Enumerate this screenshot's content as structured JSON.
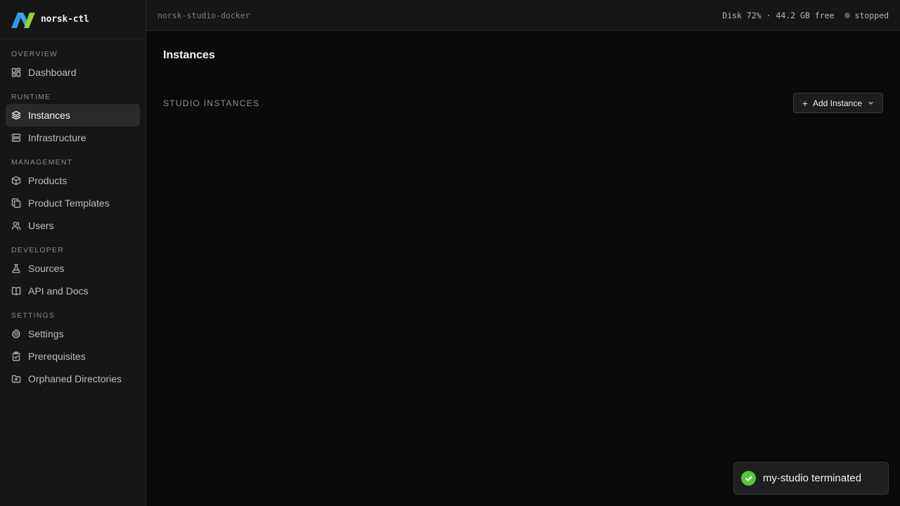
{
  "app": {
    "name": "norsk-ctl"
  },
  "topbar": {
    "host": "norsk-studio-docker",
    "disk": "Disk 72% · 44.2 GB free",
    "status": "stopped"
  },
  "sidebar": {
    "sections": [
      {
        "label": "OVERVIEW",
        "items": [
          {
            "label": "Dashboard",
            "icon": "dashboard-icon",
            "active": false
          }
        ]
      },
      {
        "label": "RUNTIME",
        "items": [
          {
            "label": "Instances",
            "icon": "layers-icon",
            "active": true
          },
          {
            "label": "Infrastructure",
            "icon": "server-icon",
            "active": false
          }
        ]
      },
      {
        "label": "MANAGEMENT",
        "items": [
          {
            "label": "Products",
            "icon": "box-icon",
            "active": false
          },
          {
            "label": "Product Templates",
            "icon": "copy-icon",
            "active": false
          },
          {
            "label": "Users",
            "icon": "users-icon",
            "active": false
          }
        ]
      },
      {
        "label": "DEVELOPER",
        "items": [
          {
            "label": "Sources",
            "icon": "flask-icon",
            "active": false
          },
          {
            "label": "API and Docs",
            "icon": "book-icon",
            "active": false
          }
        ]
      },
      {
        "label": "SETTINGS",
        "items": [
          {
            "label": "Settings",
            "icon": "gear-icon",
            "active": false
          },
          {
            "label": "Prerequisites",
            "icon": "clipboard-check-icon",
            "active": false
          },
          {
            "label": "Orphaned Directories",
            "icon": "folder-x-icon",
            "active": false
          }
        ]
      }
    ]
  },
  "main": {
    "title": "Instances",
    "section_heading": "STUDIO INSTANCES",
    "add_button_label": "Add Instance"
  },
  "toast": {
    "message": "my-studio terminated",
    "color": "#55c63c"
  },
  "colors": {
    "background": "#0a0a0b",
    "sidebar": "#161617",
    "active_item": "#2a2a2d",
    "logo_blue": "#2f9be6",
    "logo_green": "#8fd13a"
  }
}
